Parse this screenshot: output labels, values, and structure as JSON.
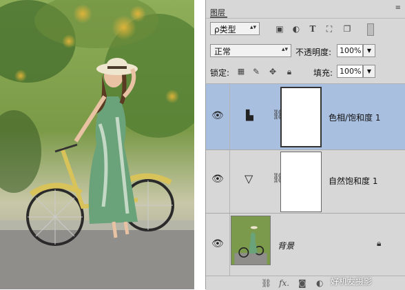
{
  "panel": {
    "tab_label": "图层",
    "filter_label": "ρ类型",
    "blend_mode": "正常",
    "opacity_label": "不透明度:",
    "opacity_value": "100%",
    "lock_label": "锁定:",
    "fill_label": "填充:",
    "fill_value": "100%"
  },
  "layers": [
    {
      "name": "色相/饱和度 1",
      "type": "adjustment",
      "icon": "hue-saturation-icon",
      "selected": true
    },
    {
      "name": "自然饱和度 1",
      "type": "adjustment",
      "icon": "vibrance-icon",
      "selected": false
    },
    {
      "name": "背景",
      "type": "background",
      "icon": "lock-icon",
      "selected": false
    }
  ],
  "watermark": "好机友摄影",
  "colors": {
    "selected": "#a9bfdf",
    "panel_bg": "#d7d7d7"
  }
}
